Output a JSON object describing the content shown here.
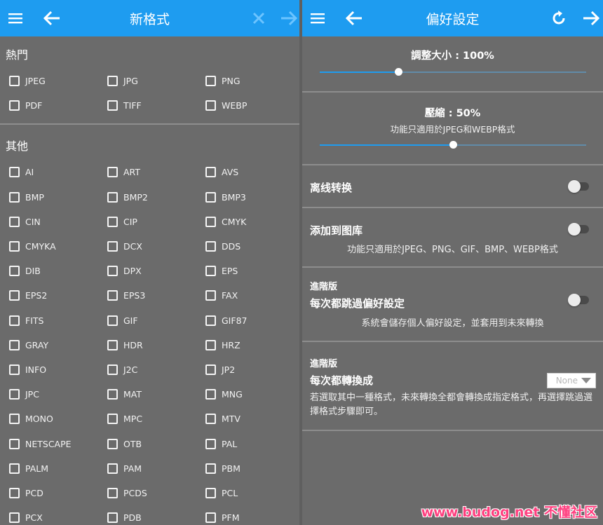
{
  "left": {
    "title": "新格式",
    "popular_title": "熱門",
    "popular": [
      "JPEG",
      "JPG",
      "PNG",
      "PDF",
      "TIFF",
      "WEBP"
    ],
    "other_title": "其他",
    "other": [
      "AI",
      "ART",
      "AVS",
      "BMP",
      "BMP2",
      "BMP3",
      "CIN",
      "CIP",
      "CMYK",
      "CMYKA",
      "DCX",
      "DDS",
      "DIB",
      "DPX",
      "EPS",
      "EPS2",
      "EPS3",
      "FAX",
      "FITS",
      "GIF",
      "GIF87",
      "GRAY",
      "HDR",
      "HRZ",
      "INFO",
      "J2C",
      "JP2",
      "JPC",
      "MAT",
      "MNG",
      "MONO",
      "MPC",
      "MTV",
      "NETSCAPE",
      "OTB",
      "PAL",
      "PALM",
      "PAM",
      "PBM",
      "PCD",
      "PCDS",
      "PCL",
      "PCX",
      "PDB",
      "PFM"
    ]
  },
  "right": {
    "title": "偏好設定",
    "resize": {
      "label": "調整大小 : 100%",
      "level": 0.295
    },
    "compress": {
      "label": "壓縮 : 50%",
      "sub": "功能只適用於JPEG和WEBP格式",
      "level": 0.5
    },
    "offline": {
      "label": "离线转换"
    },
    "gallery": {
      "label": "添加到图库",
      "sub": "功能只適用於JPEG、PNG、GIF、BMP、WEBP格式"
    },
    "skip": {
      "badge": "進階版",
      "label": "每次都跳過偏好設定",
      "sub": "系統會儲存個人偏好設定，並套用到未來轉換"
    },
    "convert": {
      "badge": "進階版",
      "label": "每次都轉換成",
      "dropdown": "None",
      "sub": "若選取其中一種格式，未來轉換全都會轉換成指定格式，再選擇跳過選擇格式步驟即可。"
    }
  },
  "watermark": "www.budog.net 不懂社区",
  "colors": {
    "appbar": "#1e9cf0",
    "background": "#6b6b6b",
    "watermark": "#ff3f7f"
  }
}
